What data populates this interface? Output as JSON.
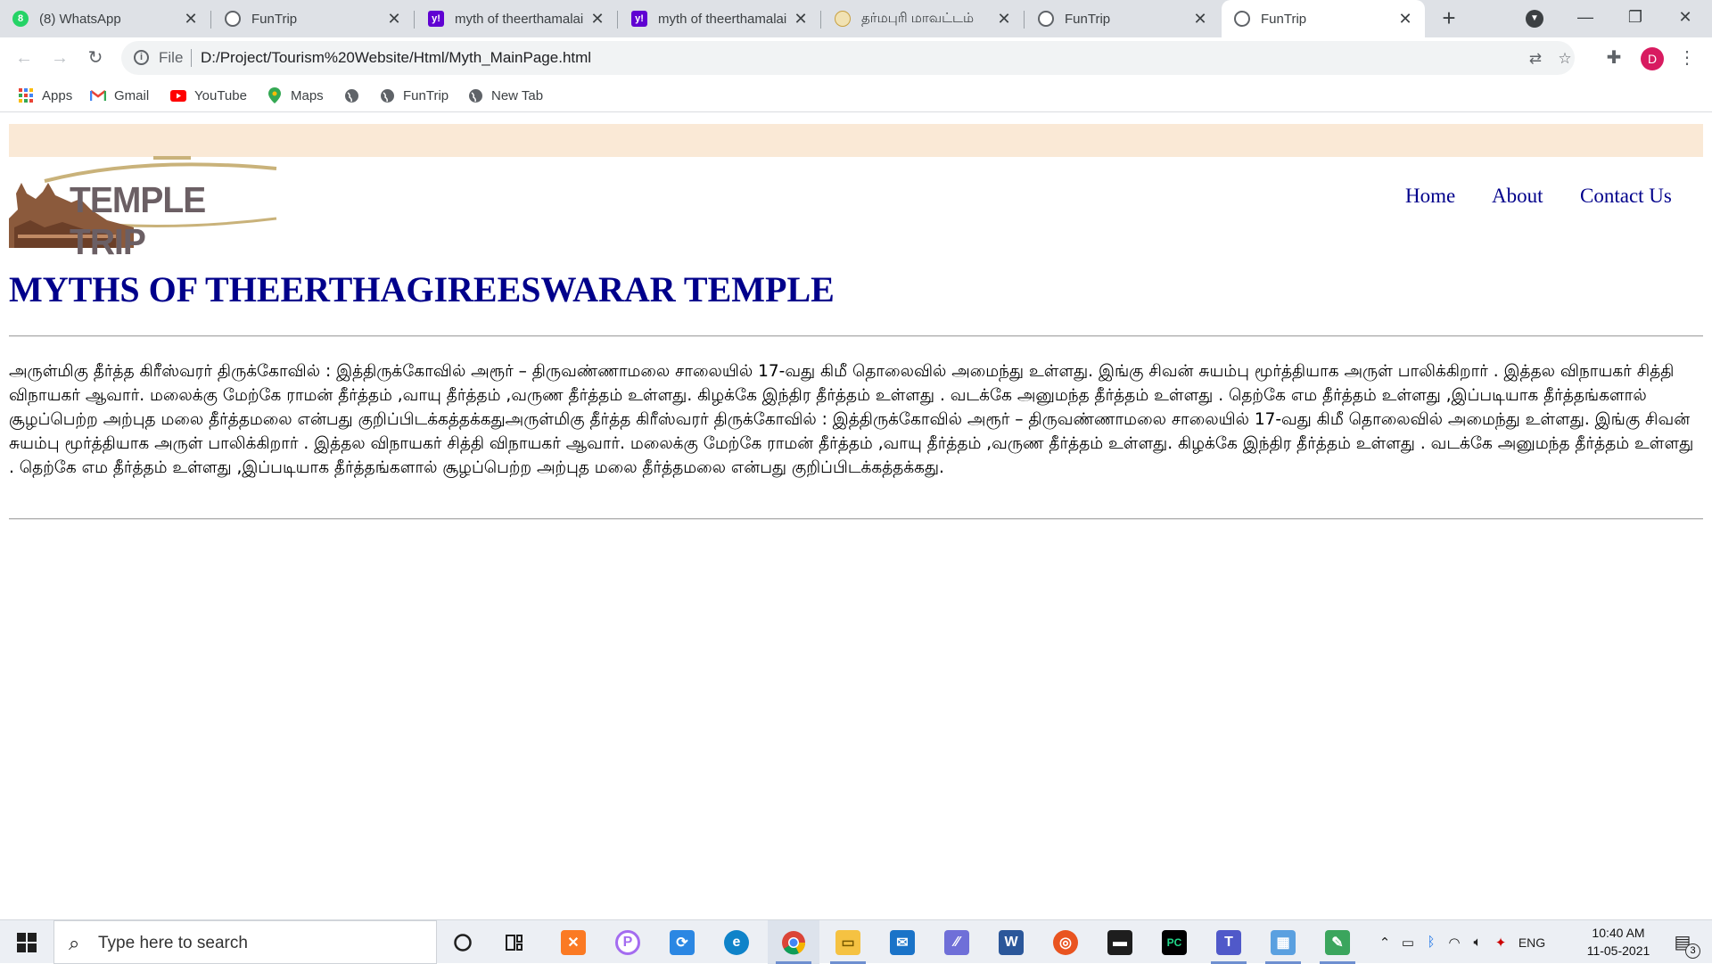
{
  "browser": {
    "tabs": [
      {
        "title": "(8) WhatsApp",
        "icon": "whatsapp-icon",
        "color": "#25d366",
        "badge": "8"
      },
      {
        "title": "FunTrip",
        "icon": "globe-icon",
        "color": "#5f6368"
      },
      {
        "title": "myth of theerthamalai",
        "icon": "yahoo-icon",
        "color": "#6001d2",
        "badge": "y!"
      },
      {
        "title": "myth of theerthamalai",
        "icon": "yahoo-icon",
        "color": "#6001d2",
        "badge": "y!"
      },
      {
        "title": "தர்மபுரி மாவட்டம்",
        "icon": "emblem-icon",
        "color": "#c8a040"
      },
      {
        "title": "FunTrip",
        "icon": "globe-icon",
        "color": "#5f6368"
      },
      {
        "title": "FunTrip",
        "icon": "globe-icon",
        "color": "#5f6368"
      }
    ],
    "new_tab_label": "+",
    "address": {
      "scheme_label": "File",
      "url": "D:/Project/Tourism%20Website/Html/Myth_MainPage.html"
    },
    "profile_initial": "D",
    "bookmarks": [
      {
        "label": "Apps",
        "icon": "apps-grid-icon"
      },
      {
        "label": "Gmail",
        "icon": "gmail-icon"
      },
      {
        "label": "YouTube",
        "icon": "youtube-icon"
      },
      {
        "label": "Maps",
        "icon": "maps-pin-icon"
      },
      {
        "label": "",
        "icon": "globe-icon"
      },
      {
        "label": "FunTrip",
        "icon": "globe-icon"
      },
      {
        "label": "New Tab",
        "icon": "globe-icon"
      }
    ]
  },
  "site": {
    "logo_text": "TEMPLE TRIP",
    "nav": [
      "Home",
      "About",
      "Contact Us"
    ],
    "heading": "MYTHS OF THEERTHAGIREESWARAR TEMPLE",
    "paragraph": "அருள்மிகு தீர்த்த கிரீஸ்வரர் திருக்கோவில் : இத்திருக்கோவில் அரூர் – திருவண்ணாமலை சாலையில் 17-வது கிமீ தொலைவில் அமைந்து உள்ளது. இங்கு சிவன் சுயம்பு மூர்த்தியாக அருள் பாலிக்கிறார் . இத்தல விநாயகர் சித்தி விநாயகர் ஆவார். மலைக்கு மேற்கே ராமன் தீர்த்தம் ,வாயு தீர்த்தம் ,வருண தீர்த்தம் உள்ளது. கிழக்கே இந்திர தீர்த்தம் உள்ளது . வடக்கே அனுமந்த தீர்த்தம் உள்ளது . தெற்கே எம தீர்த்தம் உள்ளது ,இப்படியாக தீர்த்தங்களால் சூழப்பெற்ற அற்புத மலை தீர்த்தமலை என்பது குறிப்பிடக்கத்தக்கதுஅருள்மிகு தீர்த்த கிரீஸ்வரர் திருக்கோவில் : இத்திருக்கோவில் அரூர் – திருவண்ணாமலை சாலையில் 17-வது கிமீ தொலைவில் அமைந்து உள்ளது. இங்கு சிவன் சுயம்பு மூர்த்தியாக அருள் பாலிக்கிறார் . இத்தல விநாயகர் சித்தி விநாயகர் ஆவார். மலைக்கு மேற்கே ராமன் தீர்த்தம் ,வாயு தீர்த்தம் ,வருண தீர்த்தம் உள்ளது. கிழக்கே இந்திர தீர்த்தம் உள்ளது . வடக்கே அனுமந்த தீர்த்தம் உள்ளது . தெற்கே எம தீர்த்தம் உள்ளது ,இப்படியாக தீர்த்தங்களால் சூழப்பெற்ற அற்புத மலை தீர்த்தமலை என்பது குறிப்பிடக்கத்தக்கது.",
    "colors": {
      "heading": "#00008b",
      "banner": "#fae9d6"
    }
  },
  "taskbar": {
    "search_placeholder": "Type here to search",
    "apps": [
      {
        "name": "cortana-icon"
      },
      {
        "name": "task-view-icon"
      },
      {
        "name": "xampp-icon",
        "color": "#fb7a24"
      },
      {
        "name": "picsart-icon",
        "color": "#a46cf0"
      },
      {
        "name": "sync-icon",
        "color": "#2b87e3"
      },
      {
        "name": "edge-icon",
        "color": "#0f83c9"
      },
      {
        "name": "chrome-icon",
        "color": "#db4437"
      },
      {
        "name": "file-explorer-icon",
        "color": "#f5c242"
      },
      {
        "name": "mail-icon",
        "color": "#1a73c8"
      },
      {
        "name": "visual-studio-icon",
        "color": "#6f6fd8"
      },
      {
        "name": "word-icon",
        "color": "#2b579a"
      },
      {
        "name": "ubuntu-icon",
        "color": "#e95420"
      },
      {
        "name": "terminal-icon",
        "color": "#1e1e1e"
      },
      {
        "name": "pycharm-icon",
        "color": "#000000"
      },
      {
        "name": "teams-icon",
        "color": "#5059c9"
      },
      {
        "name": "paint-icon",
        "color": "#5aa0e0"
      },
      {
        "name": "photos-icon",
        "color": "#3ba55d"
      }
    ],
    "language": "ENG",
    "time": "10:40 AM",
    "date": "11-05-2021",
    "notification_count": "3"
  }
}
